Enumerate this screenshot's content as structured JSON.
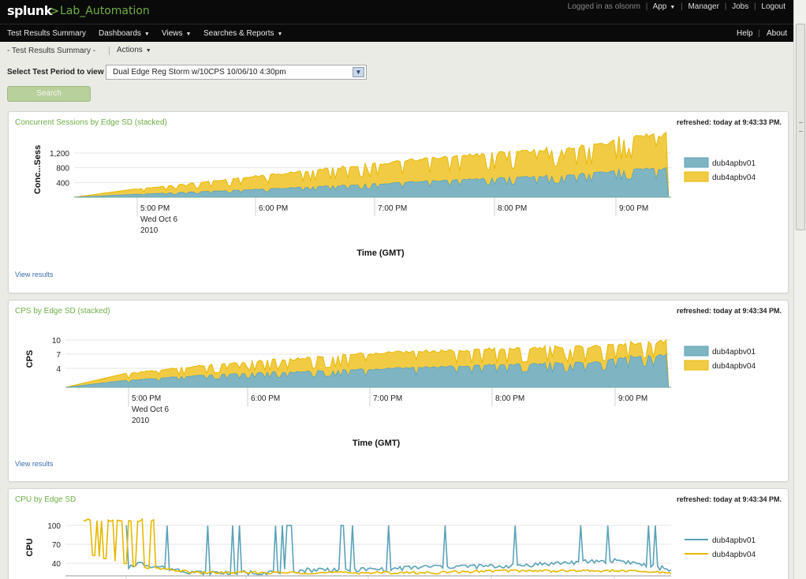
{
  "header": {
    "logo": "splunk",
    "logo_gt": ">",
    "app_name": "Lab_Automation",
    "logged_in": "Logged in as olsonm",
    "app_menu": "App",
    "manager": "Manager",
    "jobs": "Jobs",
    "logout": "Logout"
  },
  "nav": {
    "items": [
      {
        "label": "Test Results Summary",
        "dropdown": false
      },
      {
        "label": "Dashboards",
        "dropdown": true
      },
      {
        "label": "Views",
        "dropdown": true
      },
      {
        "label": "Searches & Reports",
        "dropdown": true
      }
    ],
    "help": "Help",
    "about": "About"
  },
  "controls": {
    "breadcrumb": "- Test Results Summary -",
    "actions": "Actions",
    "period_label": "Select Test Period to view",
    "period_value": "Dual Edge Reg Storm w/10CPS 10/06/10 4:30pm",
    "search_button": "Search"
  },
  "colors": {
    "series1": "#7fb5c3",
    "series1_line": "#5aa2b8",
    "series2": "#f2cb45",
    "series2_line": "#e6b800",
    "title_green": "#6fae45"
  },
  "panels": [
    {
      "title": "Concurrent Sessions by Edge SD (stacked)",
      "refreshed": "refreshed: today at 9:43:33 PM.",
      "view_results": "View results"
    },
    {
      "title": "CPS by Edge SD (stacked)",
      "refreshed": "refreshed: today at 9:43:34 PM.",
      "view_results": "View results"
    },
    {
      "title": "CPU by Edge SD",
      "refreshed": "refreshed: today at 9:43:34 PM."
    }
  ],
  "chart_data": [
    {
      "type": "area",
      "stacked": true,
      "xlabel": "Time (GMT)",
      "ylabel": "Conc...Sess",
      "x_ticks": [
        "5:00 PM\nWed Oct 6\n2010",
        "6:00 PM",
        "7:00 PM",
        "8:00 PM",
        "9:00 PM"
      ],
      "y_ticks": [
        "400",
        "800",
        "1,200"
      ],
      "ylim": [
        0,
        1500
      ],
      "x_hours": [
        16.5,
        17.0,
        17.5,
        18.0,
        18.5,
        19.0,
        19.5,
        20.0,
        20.5,
        20.9,
        21.0,
        21.2,
        21.45
      ],
      "series": [
        {
          "name": "dub4apbv01",
          "values": [
            0,
            80,
            150,
            220,
            300,
            380,
            460,
            540,
            620,
            700,
            780,
            820,
            800
          ]
        },
        {
          "name": "dub4apbv04",
          "values": [
            0,
            140,
            250,
            370,
            470,
            570,
            640,
            710,
            760,
            780,
            900,
            950,
            960
          ]
        }
      ],
      "legend": "right"
    },
    {
      "type": "area",
      "stacked": true,
      "xlabel": "Time (GMT)",
      "ylabel": "CPS",
      "x_ticks": [
        "5:00 PM\nWed Oct 6\n2010",
        "6:00 PM",
        "7:00 PM",
        "8:00 PM",
        "9:00 PM"
      ],
      "y_ticks": [
        "4",
        "7",
        "10"
      ],
      "ylim": [
        0,
        12
      ],
      "x_hours": [
        16.5,
        17.0,
        17.5,
        18.0,
        18.5,
        19.0,
        19.5,
        20.0,
        20.5,
        20.9,
        21.0,
        21.2,
        21.45
      ],
      "series": [
        {
          "name": "dub4apbv01",
          "values": [
            0,
            1.5,
            2.5,
            3.2,
            3.5,
            4.0,
            4.5,
            5.0,
            5.3,
            5.5,
            6.5,
            7.0,
            7.0
          ]
        },
        {
          "name": "dub4apbv04",
          "values": [
            0,
            1.5,
            2.0,
            2.5,
            3.0,
            3.5,
            3.5,
            3.5,
            3.5,
            3.5,
            3.0,
            3.0,
            3.0
          ]
        }
      ],
      "legend": "right"
    },
    {
      "type": "line",
      "xlabel": "",
      "ylabel": "CPU",
      "y_ticks": [
        "40",
        "70",
        "100"
      ],
      "ylim": [
        20,
        110
      ],
      "x_hours": [
        16.5,
        17.0,
        17.5,
        18.0,
        18.5,
        19.0,
        19.5,
        20.0,
        20.5,
        21.0,
        21.45
      ],
      "series": [
        {
          "name": "dub4apbv01",
          "values": [
            null,
            40,
            25,
            25,
            30,
            30,
            35,
            35,
            40,
            45,
            30
          ]
        },
        {
          "name": "dub4apbv04",
          "values": [
            60,
            35,
            25,
            25,
            25,
            25,
            25,
            28,
            28,
            28,
            25
          ]
        }
      ],
      "legend": "right"
    }
  ]
}
